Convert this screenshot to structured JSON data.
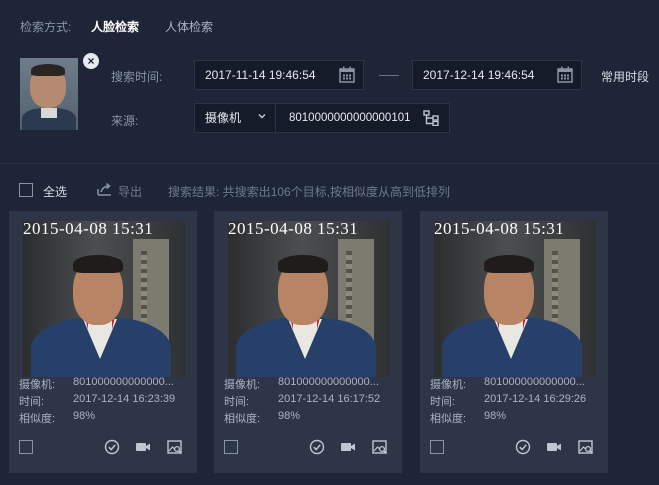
{
  "search_mode": {
    "label": "检索方式:",
    "tabs": [
      {
        "label": "人脸检索",
        "active": true
      },
      {
        "label": "人体检索",
        "active": false
      }
    ]
  },
  "filters": {
    "time_label": "搜索时间:",
    "start_time": "2017-11-14 19:46:54",
    "end_time": "2017-12-14 19:46:54",
    "common_period": "常用时段",
    "source_label": "来源:",
    "source_type": "摄像机",
    "source_id": "8010000000000000101"
  },
  "toolbar": {
    "select_all": "全选",
    "export": "导出",
    "result_summary": "搜索结果: 共搜索出106个目标,按相似度从高到低排列"
  },
  "results": [
    {
      "stamp": "2015-04-08 15:31",
      "camera_label": "摄像机:",
      "camera": "801000000000000...",
      "time_label": "时间:",
      "time": "2017-12-14 16:23:39",
      "sim_label": "相似度:",
      "similarity": "98%"
    },
    {
      "stamp": "2015-04-08 15:31",
      "camera_label": "摄像机:",
      "camera": "801000000000000...",
      "time_label": "时间:",
      "time": "2017-12-14 16:17:52",
      "sim_label": "相似度:",
      "similarity": "98%"
    },
    {
      "stamp": "2015-04-08 15:31",
      "camera_label": "摄像机:",
      "camera": "801000000000000...",
      "time_label": "时间:",
      "time": "2017-12-14 16:29:26",
      "sim_label": "相似度:",
      "similarity": "98%"
    }
  ],
  "icons": {
    "remove": "close-icon",
    "calendar": "calendar-icon",
    "dropdown": "chevron-down-icon",
    "tree": "device-tree-icon",
    "export": "export-icon",
    "confirm": "check-circle-icon",
    "video": "video-camera-icon",
    "detail": "image-search-icon"
  },
  "colors": {
    "background": "#1e2536",
    "input_bg": "#151b29",
    "card_bg": "#2e3547",
    "text": "#aab3c5",
    "active_tab": "#ffffff"
  }
}
